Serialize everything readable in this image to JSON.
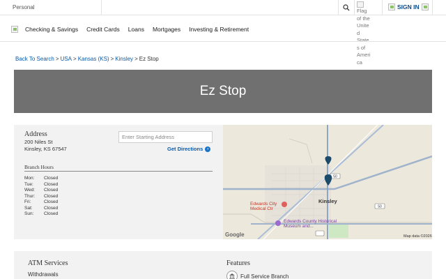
{
  "topbar": {
    "segment_label": "Personal",
    "flag_alt": "Flag of the United States of America",
    "signin_label": "SIGN IN"
  },
  "nav": {
    "items": [
      "Checking & Savings",
      "Credit Cards",
      "Loans",
      "Mortgages",
      "Investing & Retirement"
    ]
  },
  "breadcrumb": {
    "items": [
      "Back To Search",
      "USA",
      "Kansas (KS)",
      "Kinsley"
    ],
    "current": "Ez Stop",
    "separator": ">"
  },
  "hero": {
    "title": "Ez Stop"
  },
  "address": {
    "title": "Address",
    "line1": "200 Niles St",
    "line2": "Kinsley, KS 67547"
  },
  "directions": {
    "placeholder": "Enter Starting Address",
    "button_label": "Get Directions"
  },
  "hours": {
    "title": "Branch Hours",
    "rows": [
      {
        "day": "Mon:",
        "value": "Closed"
      },
      {
        "day": "Tue:",
        "value": "Closed"
      },
      {
        "day": "Wed:",
        "value": "Closed"
      },
      {
        "day": "Thur:",
        "value": "Closed"
      },
      {
        "day": "Fri:",
        "value": "Closed"
      },
      {
        "day": "Sat:",
        "value": "Closed"
      },
      {
        "day": "Sun:",
        "value": "Closed"
      }
    ]
  },
  "map": {
    "town": "Kinsley",
    "poi1": "Edwards City Medical Ctr",
    "poi2": "Edwards County Historical Museum and...",
    "shield_label": "50",
    "google": "Google",
    "copyright": "Map data ©2026"
  },
  "services": {
    "atm_title": "ATM Services",
    "atm_items": [
      "Withdrawals"
    ],
    "features_title": "Features",
    "features_items": [
      "Full Service Branch"
    ]
  },
  "colors": {
    "link": "#0a5aa8",
    "hero_bg": "#707070",
    "panel_bg": "#f2f2f2",
    "marker": "#1b4a6b"
  }
}
